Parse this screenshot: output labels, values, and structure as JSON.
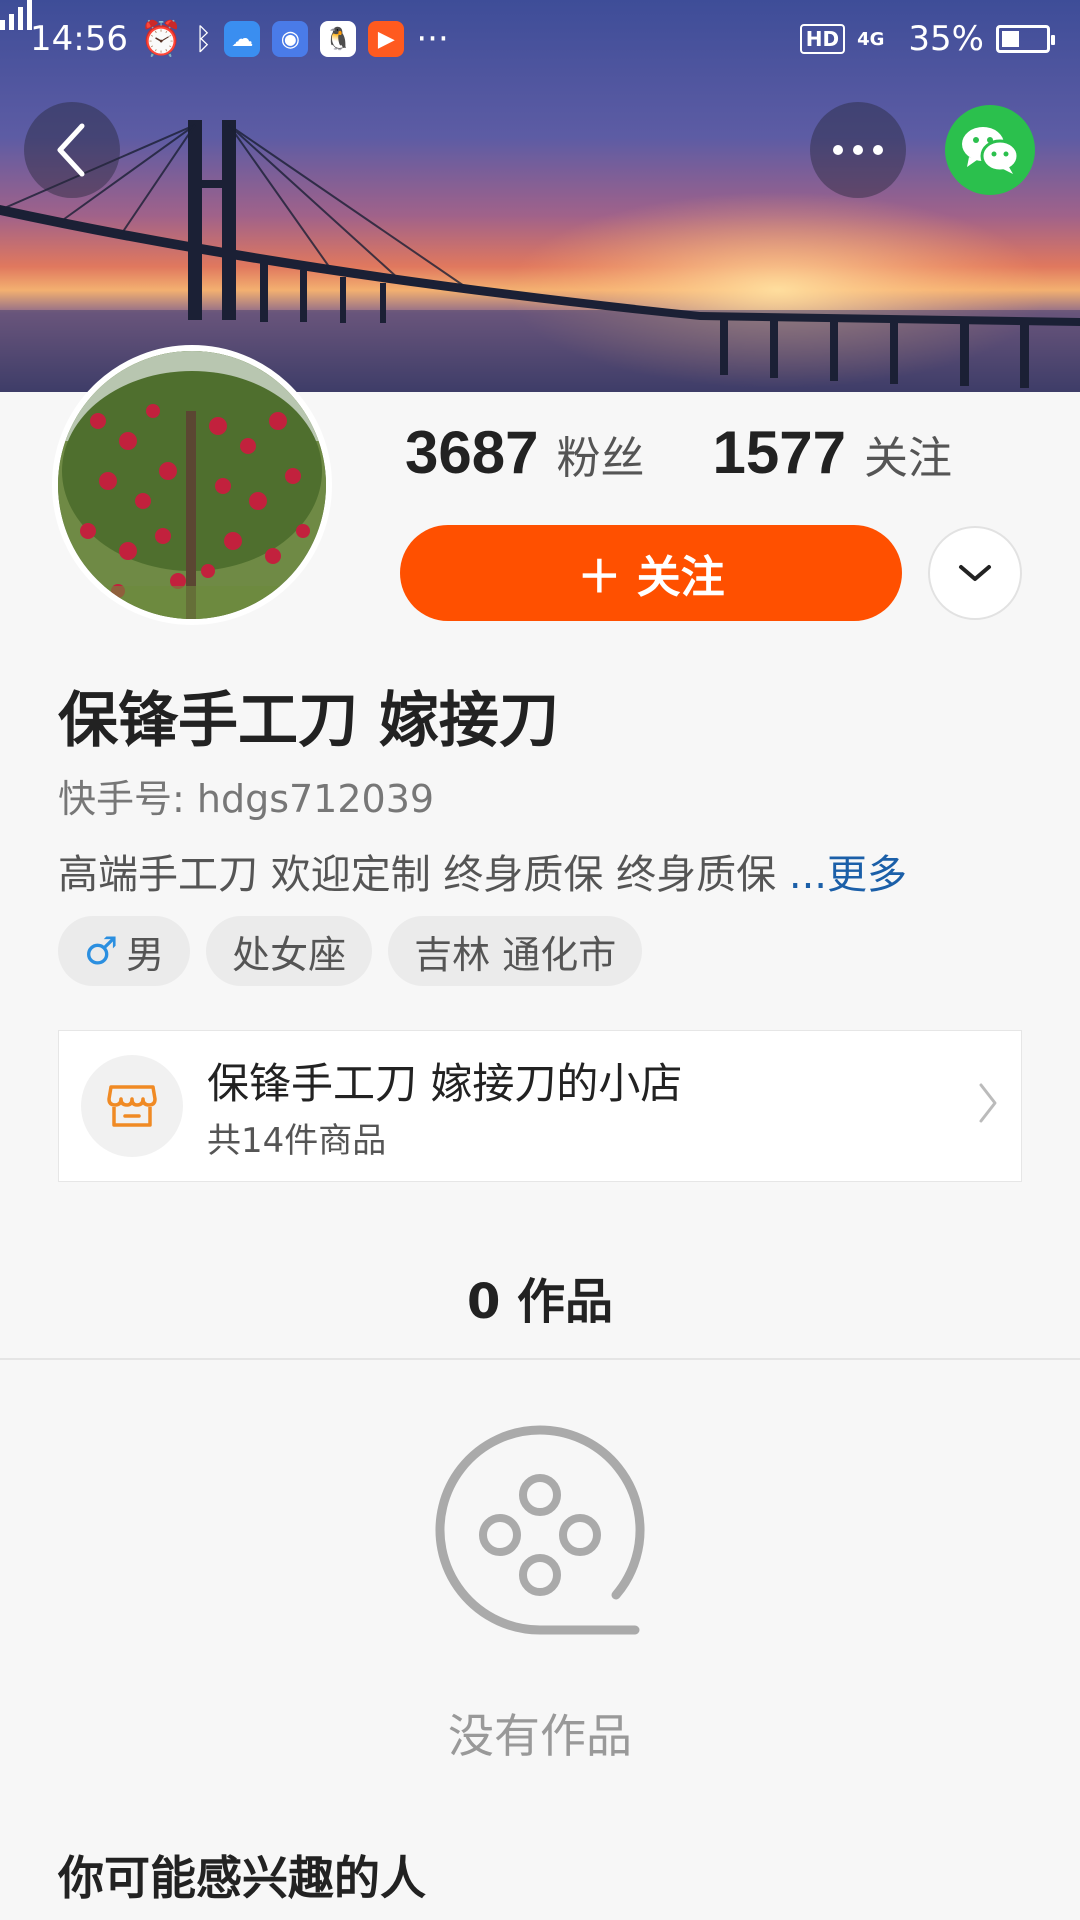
{
  "status_bar": {
    "time": "14:56",
    "more": "···",
    "hd": "HD",
    "network": "4G",
    "battery": "35%"
  },
  "icons": {
    "back": "back-arrow-icon",
    "more": "more-dots-icon",
    "wechat": "wechat-icon",
    "dropdown": "chevron-down-icon",
    "shop": "store-icon",
    "shop_chevron": "chevron-right-icon",
    "empty": "film-reel-icon"
  },
  "profile": {
    "followers_count": "3687",
    "followers_label": "粉丝",
    "following_count": "1577",
    "following_label": "关注",
    "follow_button": "＋ 关注",
    "name": "保锋手工刀 嫁接刀",
    "kwai_id": "快手号: hdgs712039",
    "bio": "高端手工刀 欢迎定制 终身质保 终身质保 ",
    "bio_more": "...更多",
    "tags": {
      "gender_symbol": "♂",
      "gender": "男",
      "zodiac": "处女座",
      "location": "吉林 通化市"
    }
  },
  "shop": {
    "title": "保锋手工刀 嫁接刀的小店",
    "subtitle": "共14件商品"
  },
  "works": {
    "count_label": "0 作品",
    "empty_text": "没有作品"
  },
  "recommend": {
    "title": "你可能感兴趣的人"
  },
  "colors": {
    "accent": "#ff5000",
    "wechat": "#2bc04d",
    "link": "#1b5fa8"
  }
}
